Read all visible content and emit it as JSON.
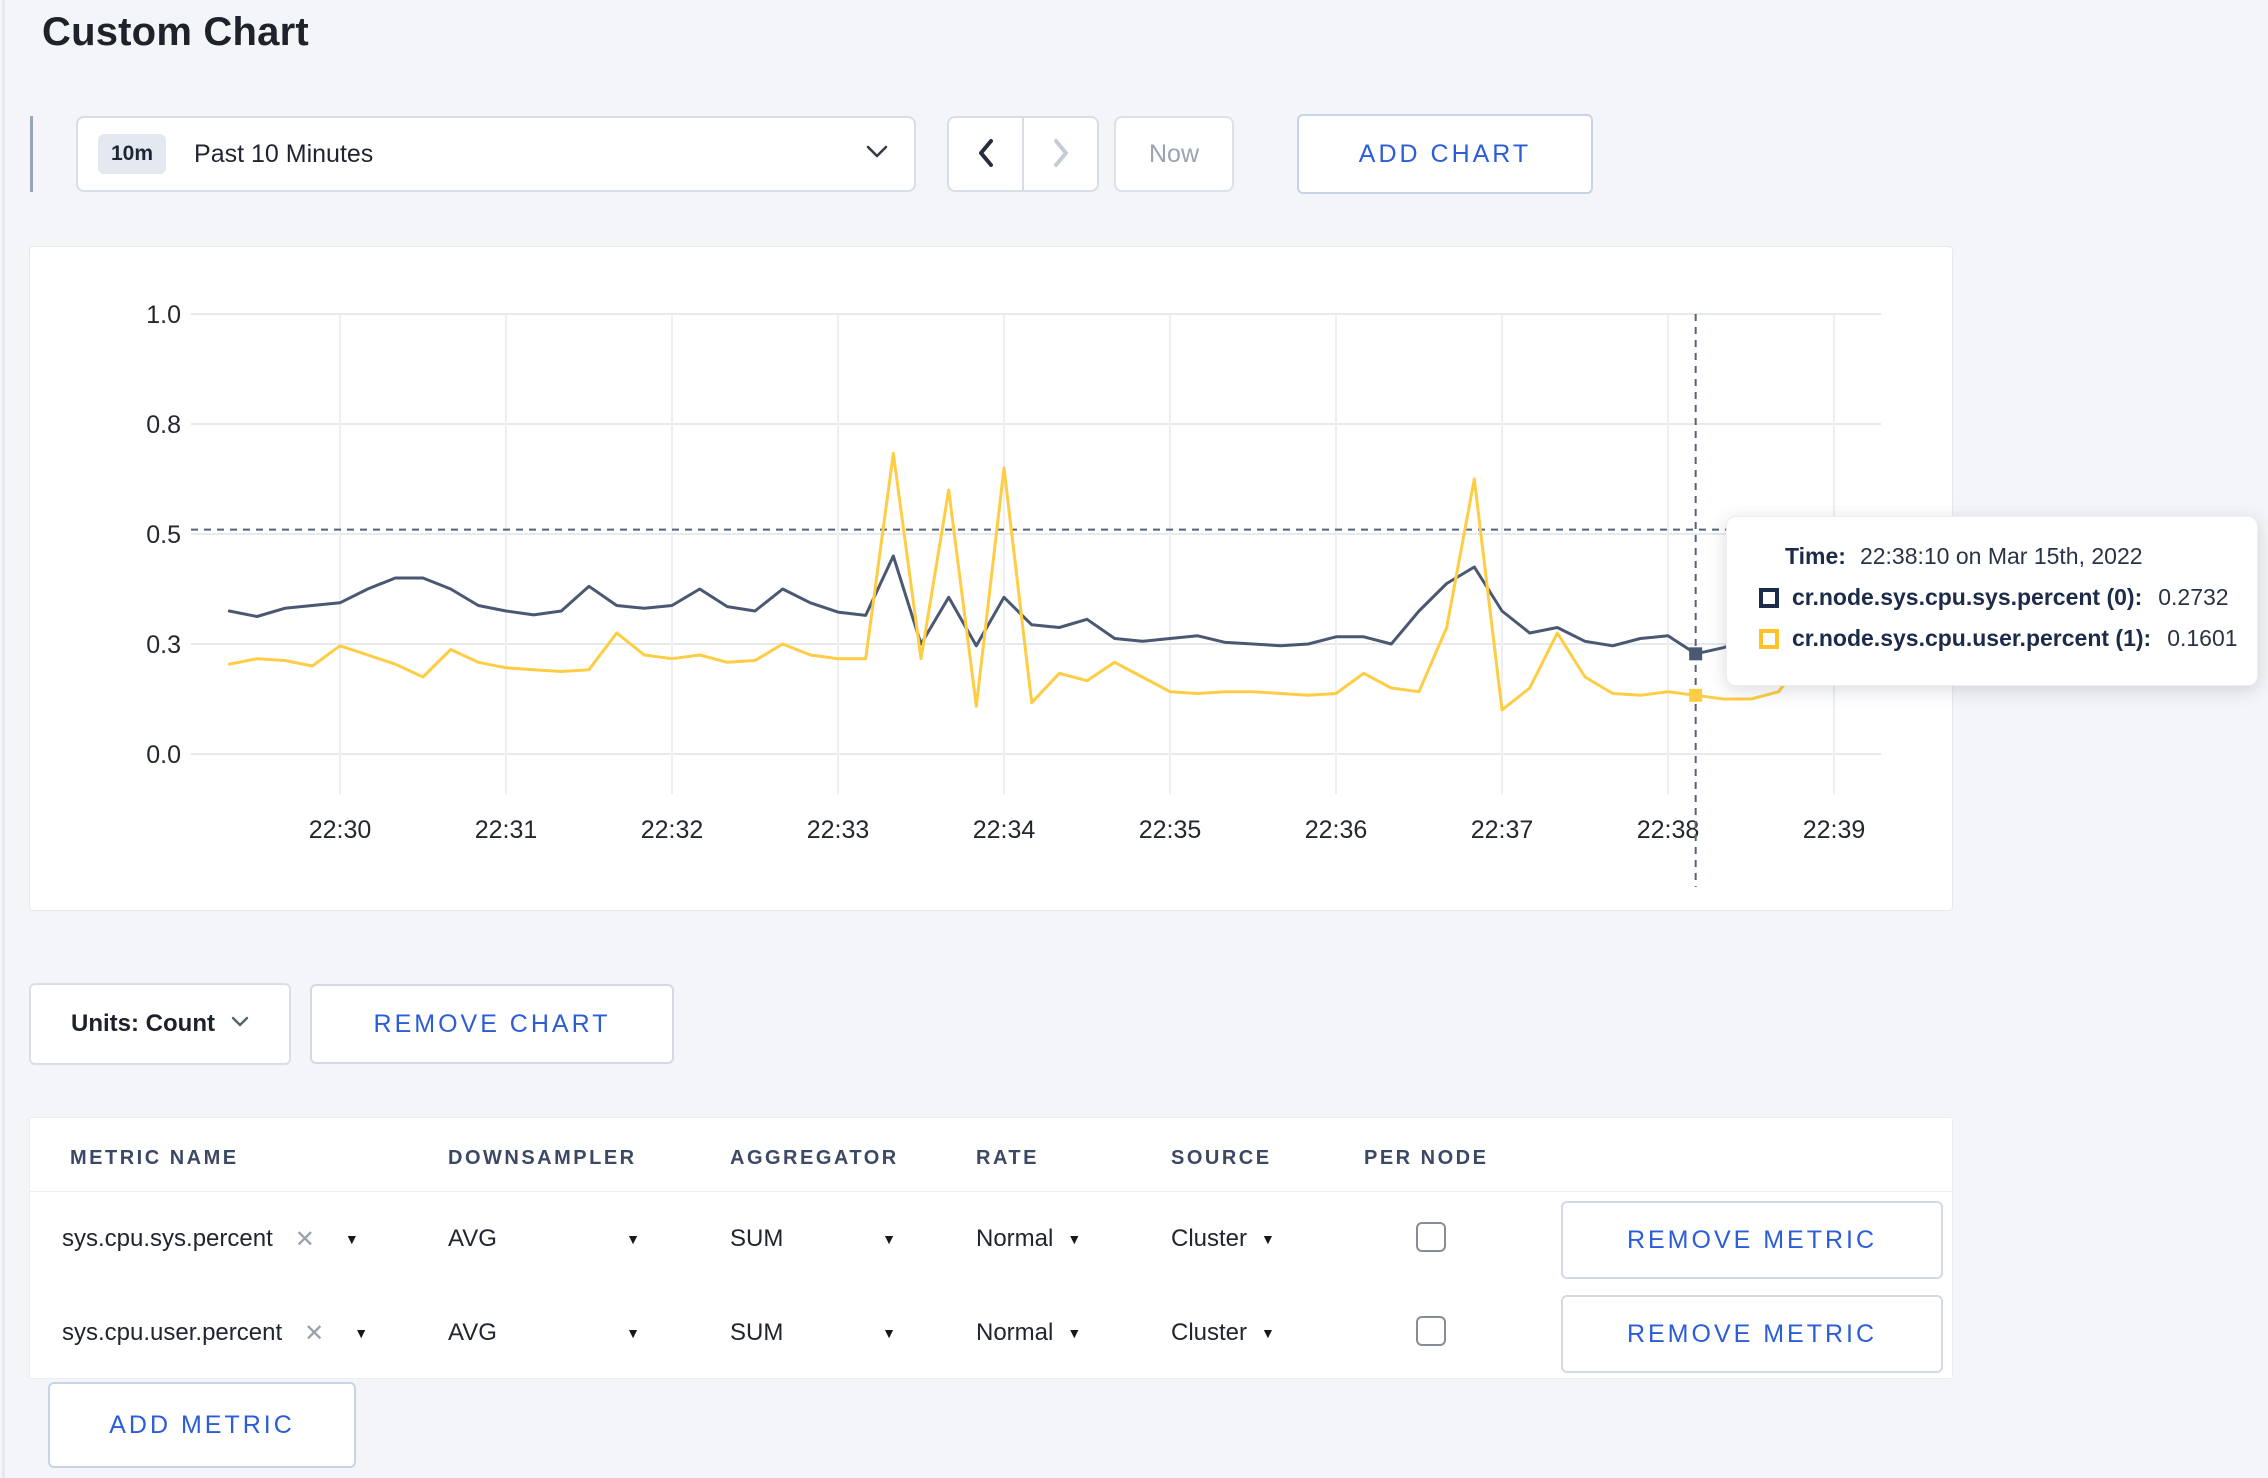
{
  "page": {
    "title": "Custom Chart",
    "background": "#f4f5f8",
    "accent_blue": "#2b5dd8"
  },
  "toolbar": {
    "time_window_badge": "10m",
    "time_window_label": "Past 10 Minutes",
    "prev_label": "previous-range",
    "next_label": "next-range",
    "now_label": "Now",
    "add_chart_label": "ADD CHART"
  },
  "glyphs": {
    "caret_down": "▼",
    "clear": "✕"
  },
  "chart_data": {
    "type": "line",
    "title": "",
    "xlabel": "",
    "ylabel": "",
    "grid": true,
    "y_ticks": [
      "0.0",
      "0.3",
      "0.5",
      "0.8",
      "1.0"
    ],
    "y_tick_values": [
      0,
      0.3,
      0.5,
      0.8,
      1.0
    ],
    "x_ticks": [
      "22:30",
      "22:31",
      "22:32",
      "22:33",
      "22:34",
      "22:35",
      "22:36",
      "22:37",
      "22:38",
      "22:39"
    ],
    "x": [
      "22:29:20",
      "22:29:30",
      "22:29:40",
      "22:29:50",
      "22:30:00",
      "22:30:10",
      "22:30:20",
      "22:30:30",
      "22:30:40",
      "22:30:50",
      "22:31:00",
      "22:31:10",
      "22:31:20",
      "22:31:30",
      "22:31:40",
      "22:31:50",
      "22:32:00",
      "22:32:10",
      "22:32:20",
      "22:32:30",
      "22:32:40",
      "22:32:50",
      "22:33:00",
      "22:33:10",
      "22:33:20",
      "22:33:30",
      "22:33:40",
      "22:33:50",
      "22:34:00",
      "22:34:10",
      "22:34:20",
      "22:34:30",
      "22:34:40",
      "22:34:50",
      "22:35:00",
      "22:35:10",
      "22:35:20",
      "22:35:30",
      "22:35:40",
      "22:35:50",
      "22:36:00",
      "22:36:10",
      "22:36:20",
      "22:36:30",
      "22:36:40",
      "22:36:50",
      "22:37:00",
      "22:37:10",
      "22:37:20",
      "22:37:30",
      "22:37:40",
      "22:37:50",
      "22:38:00",
      "22:38:10",
      "22:38:20",
      "22:38:30",
      "22:38:40",
      "22:38:50",
      "22:39:00",
      "22:39:10"
    ],
    "series": [
      {
        "name": "cr.node.sys.cpu.sys.percent (0)",
        "color": "#4a5872",
        "legend_color": "#1c2b4a",
        "values": [
          0.36,
          0.35,
          0.365,
          0.37,
          0.375,
          0.4,
          0.42,
          0.42,
          0.4,
          0.37,
          0.36,
          0.353,
          0.36,
          0.405,
          0.37,
          0.365,
          0.37,
          0.4,
          0.368,
          0.36,
          0.4,
          0.375,
          0.358,
          0.352,
          0.46,
          0.3,
          0.385,
          0.295,
          0.385,
          0.335,
          0.33,
          0.345,
          0.31,
          0.305,
          0.31,
          0.315,
          0.303,
          0.3,
          0.295,
          0.3,
          0.313,
          0.313,
          0.3,
          0.36,
          0.41,
          0.44,
          0.36,
          0.32,
          0.33,
          0.305,
          0.295,
          0.31,
          0.315,
          0.2732,
          0.29,
          0.31,
          0.295,
          0.285,
          0.3,
          0.33
        ]
      },
      {
        "name": "cr.node.sys.cpu.user.percent (1)",
        "color": "#ffcd44",
        "legend_color": "#ffc226",
        "values": [
          0.245,
          0.26,
          0.255,
          0.24,
          0.295,
          0.27,
          0.245,
          0.21,
          0.285,
          0.25,
          0.235,
          0.23,
          0.225,
          0.23,
          0.32,
          0.27,
          0.26,
          0.27,
          0.25,
          0.255,
          0.3,
          0.27,
          0.26,
          0.26,
          0.72,
          0.26,
          0.62,
          0.13,
          0.68,
          0.14,
          0.22,
          0.2,
          0.25,
          0.21,
          0.17,
          0.165,
          0.17,
          0.17,
          0.165,
          0.16,
          0.165,
          0.22,
          0.18,
          0.17,
          0.33,
          0.65,
          0.12,
          0.18,
          0.32,
          0.21,
          0.165,
          0.16,
          0.17,
          0.1601,
          0.15,
          0.15,
          0.17,
          0.27,
          0.23,
          0.27
        ]
      }
    ],
    "crosshair": {
      "time": "22:38:10",
      "y_value": 0.512,
      "color": "#55627c"
    },
    "cursor_points": [
      {
        "series": 0,
        "value": 0.2732
      },
      {
        "series": 1,
        "value": 0.1601
      }
    ]
  },
  "tooltip": {
    "time_label": "Time:",
    "time_value": "22:38:10 on Mar 15th, 2022",
    "rows": [
      {
        "name": "cr.node.sys.cpu.sys.percent (0):",
        "value": "0.2732",
        "swatch": "#1c2b4a"
      },
      {
        "name": "cr.node.sys.cpu.user.percent (1):",
        "value": "0.1601",
        "swatch": "#ffc226"
      }
    ]
  },
  "controls": {
    "units_label": "Units: Count",
    "remove_chart_label": "REMOVE CHART",
    "add_metric_label": "ADD METRIC"
  },
  "metrics_table": {
    "headers": [
      "METRIC NAME",
      "DOWNSAMPLER",
      "AGGREGATOR",
      "RATE",
      "SOURCE",
      "PER NODE"
    ],
    "remove_metric_label": "REMOVE METRIC",
    "rows": [
      {
        "metric": "sys.cpu.sys.percent",
        "downsampler": "AVG",
        "aggregator": "SUM",
        "rate": "Normal",
        "source": "Cluster",
        "per_node": false
      },
      {
        "metric": "sys.cpu.user.percent",
        "downsampler": "AVG",
        "aggregator": "SUM",
        "rate": "Normal",
        "source": "Cluster",
        "per_node": false
      }
    ]
  }
}
